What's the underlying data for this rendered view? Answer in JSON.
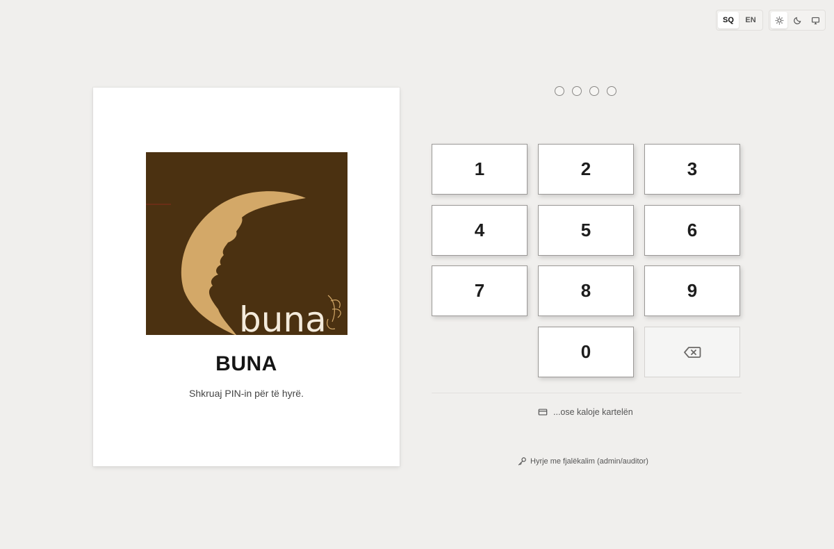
{
  "toolbar": {
    "languages": [
      {
        "code": "SQ",
        "active": true
      },
      {
        "code": "EN",
        "active": false
      }
    ],
    "themes": [
      {
        "icon": "sun-icon",
        "active": true
      },
      {
        "icon": "moon-icon",
        "active": false
      },
      {
        "icon": "monitor-icon",
        "active": false
      }
    ]
  },
  "brand": {
    "logo_text": "buna",
    "title": "BUNA",
    "subtitle": "Shkruaj PIN-in për të hyrë."
  },
  "pin": {
    "length": 4,
    "filled": 0
  },
  "keypad": {
    "keys": [
      "1",
      "2",
      "3",
      "4",
      "5",
      "6",
      "7",
      "8",
      "9",
      "0"
    ],
    "backspace_icon": "backspace-icon"
  },
  "card_login": {
    "label": "...ose kaloje kartelën",
    "icon": "credit-card-icon"
  },
  "password_login": {
    "label": "Hyrje me fjalëkalim (admin/auditor)",
    "icon": "key-icon"
  },
  "colors": {
    "background": "#f0efed",
    "logo_background": "#4b3111",
    "logo_accent": "#d3a868"
  }
}
